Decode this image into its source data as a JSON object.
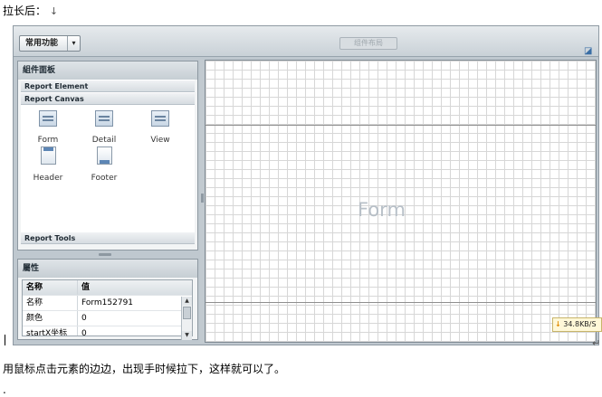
{
  "doc": {
    "heading": "拉长后：",
    "heading_mark": "↓",
    "caption": "用鼠标点击元素的边边，出现手时候拉下，这样就可以了。",
    "trailing_mark": "↵",
    "bottom_mark": "."
  },
  "toolbar": {
    "menu_label": "常用功能",
    "menu_arrow": "▾",
    "center_button": "组件布局"
  },
  "component_panel": {
    "title": "組件面板",
    "sections": {
      "element": "Report Element",
      "canvas": "Report Canvas",
      "tools": "Report Tools"
    },
    "canvas_items": [
      "Form",
      "Detail",
      "View",
      "Header",
      "Footer"
    ]
  },
  "properties": {
    "title": "屬性",
    "col_name": "名称",
    "col_value": "值",
    "rows": [
      {
        "name": "名称",
        "value": "Form152791"
      },
      {
        "name": "颜色",
        "value": "0"
      },
      {
        "name": "startX坐标",
        "value": "0"
      }
    ],
    "scroll_up": "▲",
    "scroll_down": "▼"
  },
  "designer": {
    "form_label": "Form"
  },
  "download": {
    "arrow": "↓",
    "text": "34.8KB/S"
  },
  "colors": {
    "frame": "#bfc8cf",
    "grid": "#d7d7d7",
    "watermark": "#b8c0c8"
  }
}
